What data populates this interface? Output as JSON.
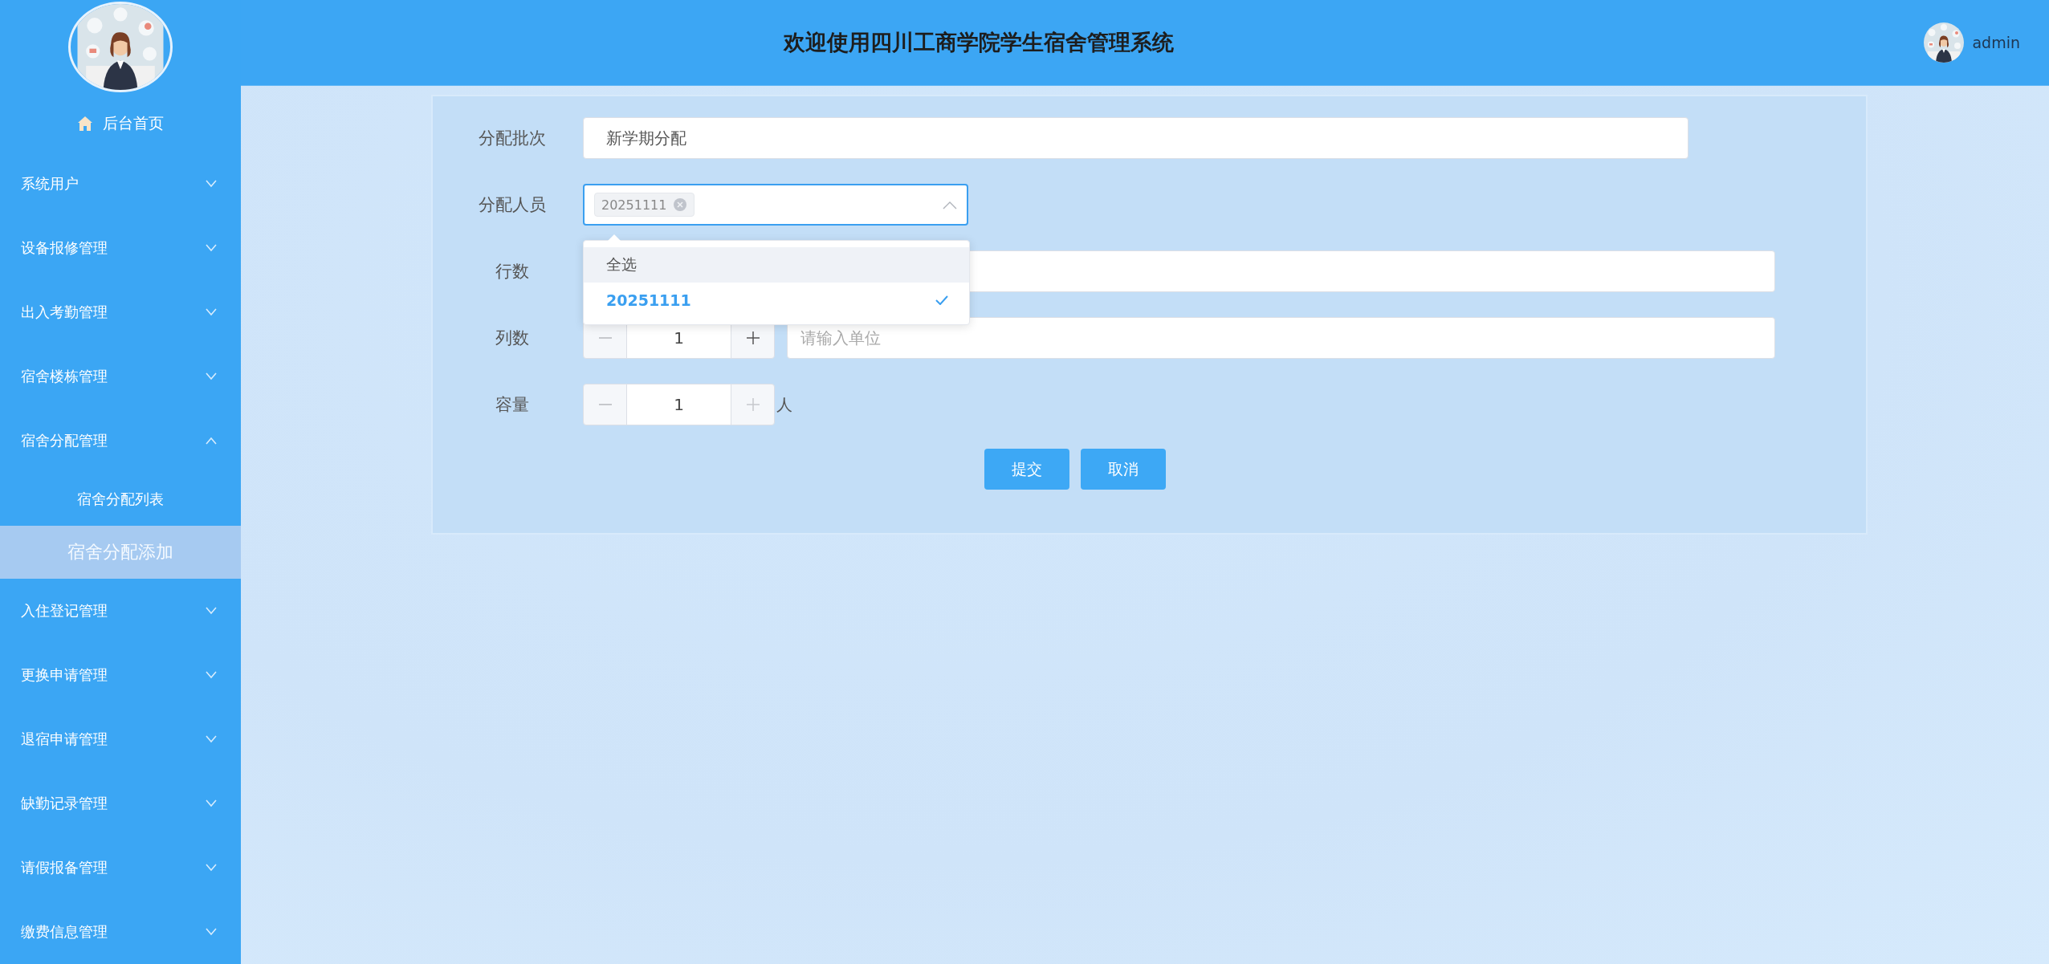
{
  "sidebar": {
    "items": [
      {
        "kind": "home",
        "label": "后台首页"
      },
      {
        "kind": "menu",
        "label": "系统用户",
        "expanded": false
      },
      {
        "kind": "menu",
        "label": "设备报修管理",
        "expanded": false
      },
      {
        "kind": "menu",
        "label": "出入考勤管理",
        "expanded": false
      },
      {
        "kind": "menu",
        "label": "宿舍楼栋管理",
        "expanded": false
      },
      {
        "kind": "menu",
        "label": "宿舍分配管理",
        "expanded": true,
        "children": [
          {
            "label": "宿舍分配列表",
            "selected": false
          },
          {
            "label": "宿舍分配添加",
            "selected": true
          }
        ]
      },
      {
        "kind": "menu",
        "label": "入住登记管理",
        "expanded": false
      },
      {
        "kind": "menu",
        "label": "更换申请管理",
        "expanded": false
      },
      {
        "kind": "menu",
        "label": "退宿申请管理",
        "expanded": false
      },
      {
        "kind": "menu",
        "label": "缺勤记录管理",
        "expanded": false
      },
      {
        "kind": "menu",
        "label": "请假报备管理",
        "expanded": false
      },
      {
        "kind": "menu",
        "label": "缴费信息管理",
        "expanded": false
      }
    ]
  },
  "header": {
    "title": "欢迎使用四川工商学院学生宿舍管理系统",
    "user": {
      "name": "admin"
    }
  },
  "form": {
    "fields": [
      {
        "kind": "text",
        "label": "分配批次",
        "value": "新学期分配"
      },
      {
        "kind": "select",
        "label": "分配人员",
        "focused": true,
        "tags": [
          "20251111"
        ],
        "open": true,
        "options": [
          {
            "label": "全选",
            "hovered": true,
            "selected": false
          },
          {
            "label": "20251111",
            "hovered": false,
            "selected": true
          }
        ]
      },
      {
        "kind": "stepper",
        "label": "行数",
        "unit_field": true
      },
      {
        "kind": "stepper",
        "label": "列数",
        "value": "1",
        "minus_disabled": true,
        "plus_disabled": false,
        "unit_field": true,
        "unit_placeholder": "请输入单位"
      },
      {
        "kind": "stepper",
        "label": "容量",
        "value": "1",
        "minus_disabled": true,
        "plus_disabled": true,
        "suffix": "人"
      }
    ],
    "buttons": [
      {
        "label": "提交"
      },
      {
        "label": "取消"
      }
    ]
  }
}
